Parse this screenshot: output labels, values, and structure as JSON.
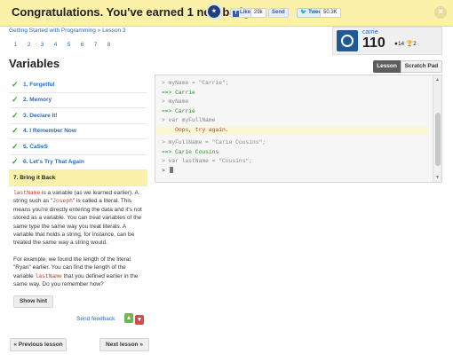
{
  "banner": {
    "title": "Congratulations. You've earned 1 new badge",
    "badge_icon": "badge-icon",
    "fb_like_label": "Like",
    "fb_like_count": "29k",
    "fb_send_label": "Send",
    "tweet_label": "Tweet",
    "tweet_count": "50.3K",
    "close_label": "×"
  },
  "breadcrumb": "Getting Started with Programming » Lesson 3",
  "steps": [
    "1",
    "2",
    "3",
    "4",
    "5",
    "6",
    "7",
    "8"
  ],
  "profile": {
    "username": "carrie",
    "score": "110",
    "badges_text": "14",
    "trophies_text": "2"
  },
  "page_title": "Variables",
  "lessons": [
    {
      "label": "1. Forgetful",
      "done": true
    },
    {
      "label": "2. Memory",
      "done": true
    },
    {
      "label": "3. Declare It!",
      "done": true
    },
    {
      "label": "4. I Remember Now",
      "done": true
    },
    {
      "label": "5. CaSeS",
      "done": true
    },
    {
      "label": "6. Let's Try That Again",
      "done": true
    },
    {
      "label": "7. Bring it Back",
      "done": false
    }
  ],
  "description": {
    "p1_code1": "lastName",
    "p1_text1": " is a variable (as we learned earlier). A string such as \"",
    "p1_code2": "Joseph",
    "p1_text2": "\" is called a literal. This means you're directly entering the data and it's not stored as a variable. You can treat variables of the same type the same way you treat literals. A variable that holds a string, for instance, can be treated the same way a string would.",
    "p2_text1": "For example, we found the length of the literal \"Ryan\" earlier. You can find the length of the variable ",
    "p2_code1": "lastName",
    "p2_text2": " that you defined earlier in the same way. Do you remember how?"
  },
  "buttons": {
    "show_hint": "Show hint",
    "send_feedback": "Send feedback",
    "prev": "« Previous lesson",
    "next": "Next lesson »"
  },
  "tabs": {
    "lesson": "Lesson",
    "scratch": "Scratch Pad"
  },
  "console": [
    {
      "type": "in",
      "text": "> myName = \"Carrie\";"
    },
    {
      "type": "out",
      "text": "==> Carrie"
    },
    {
      "type": "in",
      "text": "> myName"
    },
    {
      "type": "out",
      "text": "==> Carrie"
    },
    {
      "type": "in",
      "text": "> var myFullName"
    },
    {
      "type": "err",
      "text": "    Oops, try again."
    },
    {
      "type": "gap",
      "text": ""
    },
    {
      "type": "in",
      "text": "> myFullName = \"Carie Cousins\";"
    },
    {
      "type": "out",
      "text": "==> Carie Cousins"
    },
    {
      "type": "in",
      "text": "> var lastName = \"Cousins\";"
    },
    {
      "type": "prompt",
      "text": "> "
    }
  ]
}
